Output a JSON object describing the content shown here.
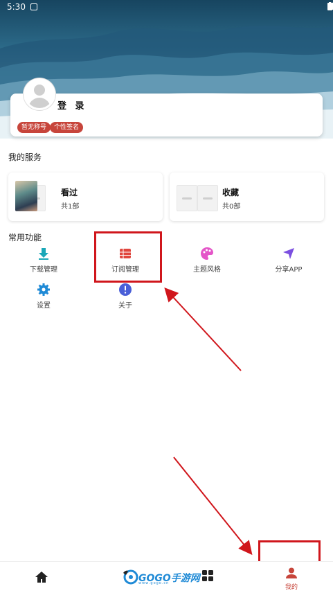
{
  "status_bar": {
    "time": "5:30"
  },
  "profile": {
    "name": "登 录",
    "tags": [
      "暂无称号",
      "个性签名"
    ]
  },
  "services": {
    "title": "我的服务",
    "items": [
      {
        "label": "看过",
        "count": "共1部"
      },
      {
        "label": "收藏",
        "count": "共0部"
      }
    ]
  },
  "functions": {
    "title": "常用功能",
    "items": [
      {
        "label": "下载管理",
        "icon": "download-icon",
        "color": "#1aa7b8"
      },
      {
        "label": "订阅管理",
        "icon": "subscription-list-icon",
        "color": "#e0463e"
      },
      {
        "label": "主题风格",
        "icon": "palette-icon",
        "color": "#e455c8"
      },
      {
        "label": "分享APP",
        "icon": "send-icon",
        "color": "#7b4fe0"
      },
      {
        "label": "设置",
        "icon": "gear-icon",
        "color": "#1f8ad6"
      },
      {
        "label": "关于",
        "icon": "info-icon",
        "color": "#4a5fd8"
      }
    ]
  },
  "bottom_nav": {
    "mine": "我的"
  },
  "watermark": {
    "text": "GOGO手游网",
    "sub": "www.gogo.cn"
  },
  "colors": {
    "accent": "#c7453b",
    "annotation": "#d0161c"
  }
}
